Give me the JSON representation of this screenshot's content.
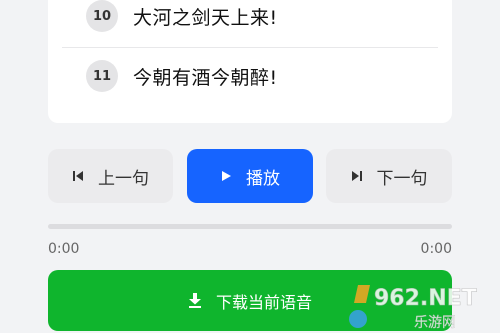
{
  "lines": [
    {
      "num": "10",
      "text": "大河之剑天上来!"
    },
    {
      "num": "11",
      "text": "今朝有酒今朝醉!"
    }
  ],
  "controls": {
    "prev_label": "上一句",
    "play_label": "播放",
    "next_label": "下一句"
  },
  "playback": {
    "progress": 0,
    "current_time": "0:00",
    "total_time": "0:00"
  },
  "download": {
    "label": "下载当前语音"
  },
  "watermark": {
    "logo_text": "962.NET",
    "sub_text": "乐游网"
  },
  "icons": {
    "prev": "skip-previous-icon",
    "play": "play-icon",
    "next": "skip-next-icon",
    "download": "download-icon"
  },
  "colors": {
    "primary": "#1664ff",
    "download": "#0fb52d",
    "secondary_button": "#ebebed",
    "background": "#f2f3f5"
  }
}
